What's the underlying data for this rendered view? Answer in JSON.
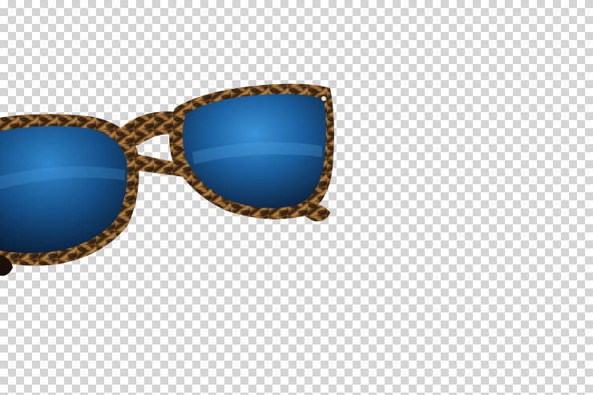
{
  "image": {
    "subject_icon": "sunglasses-icon",
    "background": "transparency-checkerboard",
    "colors": {
      "checker_light": "#ffffff",
      "checker_dark": "#d4d4d4",
      "frame_tortoise_dark": "#2a1a0e",
      "frame_tortoise_light": "#b07a3a",
      "lens_blue": "#1e6fb5",
      "lens_dark": "#0b1f38"
    }
  }
}
